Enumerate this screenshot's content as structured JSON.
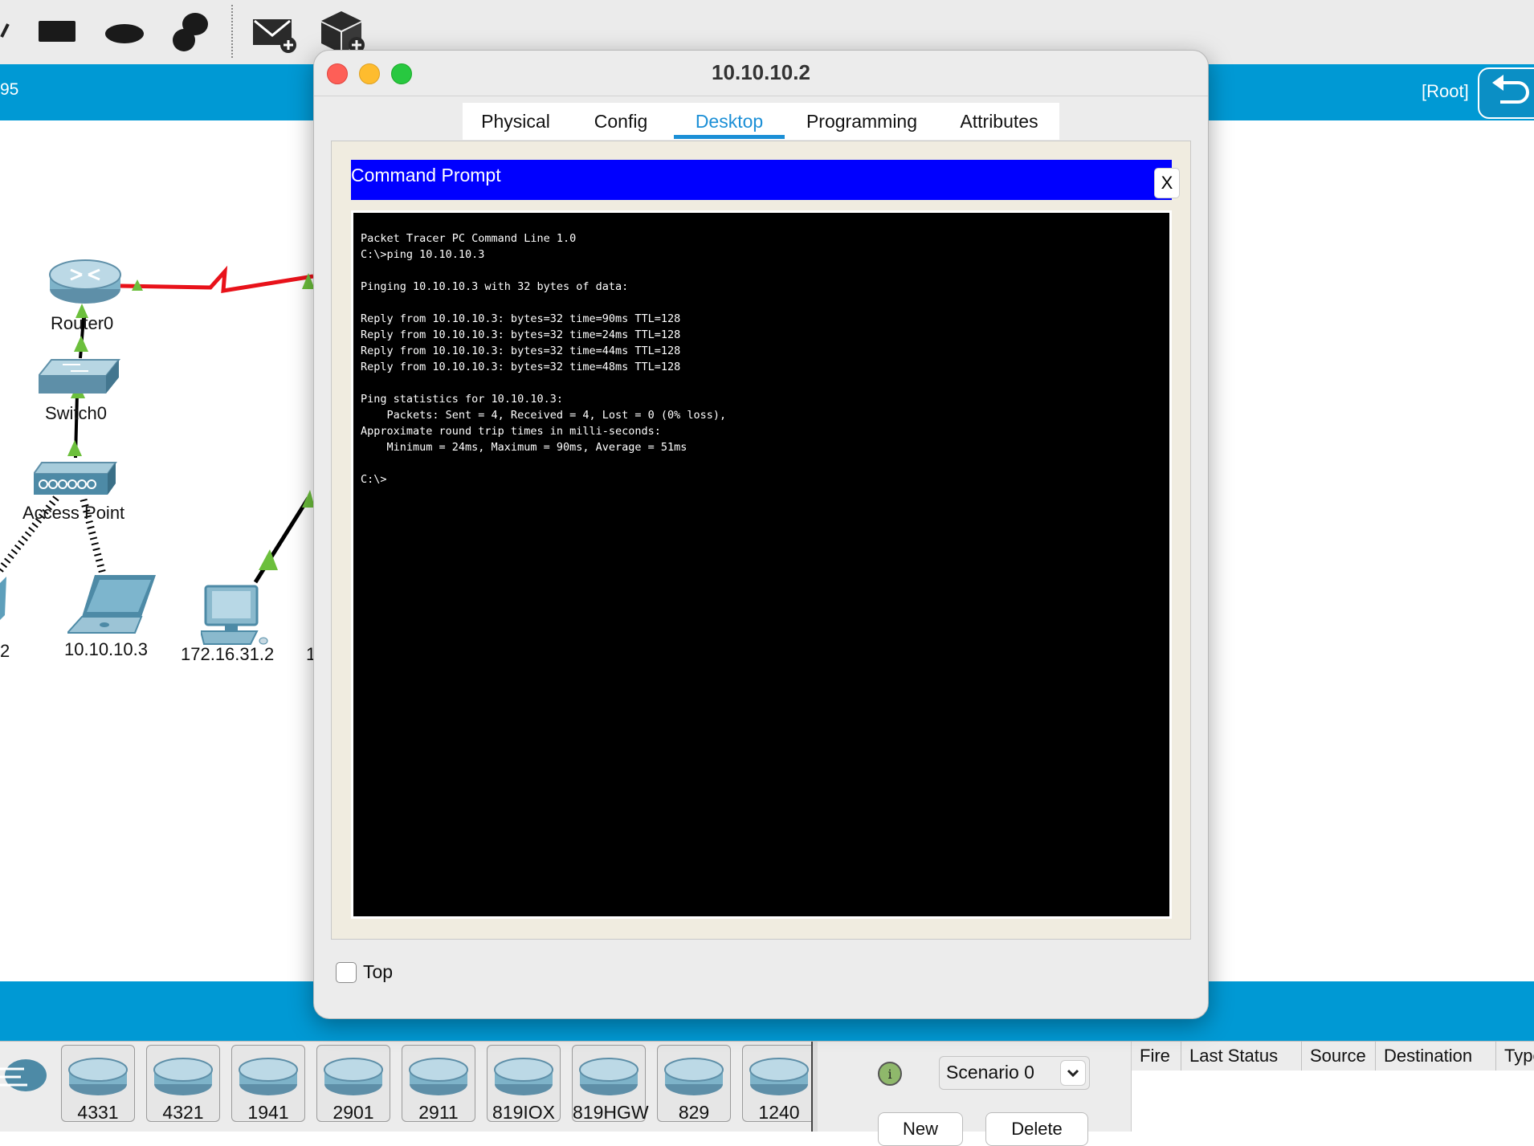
{
  "colors": {
    "accent_blue": "#0099d4",
    "cmd_header": "#0000ff",
    "terminal_bg": "#000000",
    "link_red": "#e8121a",
    "tab_active": "#1b8fd6"
  },
  "workspace": {
    "left_label": "95",
    "root_label": "[Root]"
  },
  "network": {
    "router_label": "Router0",
    "switch_label": "Switch0",
    "ap_label": "Access Point",
    "laptop_left_label": "2",
    "laptop_label": "10.10.10.3",
    "pc_label": "172.16.31.2",
    "pc_right_label": "1"
  },
  "dialog": {
    "title": "10.10.10.2",
    "tabs": [
      "Physical",
      "Config",
      "Desktop",
      "Programming",
      "Attributes"
    ],
    "active_tab": "Desktop",
    "command_prompt_title": "Command Prompt",
    "close_label": "X",
    "top_checkbox_label": "Top"
  },
  "terminal_lines": [
    "Packet Tracer PC Command Line 1.0",
    "C:\\>ping 10.10.10.3",
    "",
    "Pinging 10.10.10.3 with 32 bytes of data:",
    "",
    "Reply from 10.10.10.3: bytes=32 time=90ms TTL=128",
    "Reply from 10.10.10.3: bytes=32 time=24ms TTL=128",
    "Reply from 10.10.10.3: bytes=32 time=44ms TTL=128",
    "Reply from 10.10.10.3: bytes=32 time=48ms TTL=128",
    "",
    "Ping statistics for 10.10.10.3:",
    "    Packets: Sent = 4, Received = 4, Lost = 0 (0% loss),",
    "Approximate round trip times in milli-seconds:",
    "    Minimum = 24ms, Maximum = 90ms, Average = 51ms",
    "",
    "C:\\>"
  ],
  "devices": [
    "4331",
    "4321",
    "1941",
    "2901",
    "2911",
    "819IOX",
    "819HGW",
    "829",
    "1240"
  ],
  "scenario": {
    "selected": "Scenario 0",
    "new_label": "New",
    "delete_label": "Delete"
  },
  "pdu_columns": [
    "Fire",
    "Last Status",
    "Source",
    "Destination",
    "Type"
  ]
}
